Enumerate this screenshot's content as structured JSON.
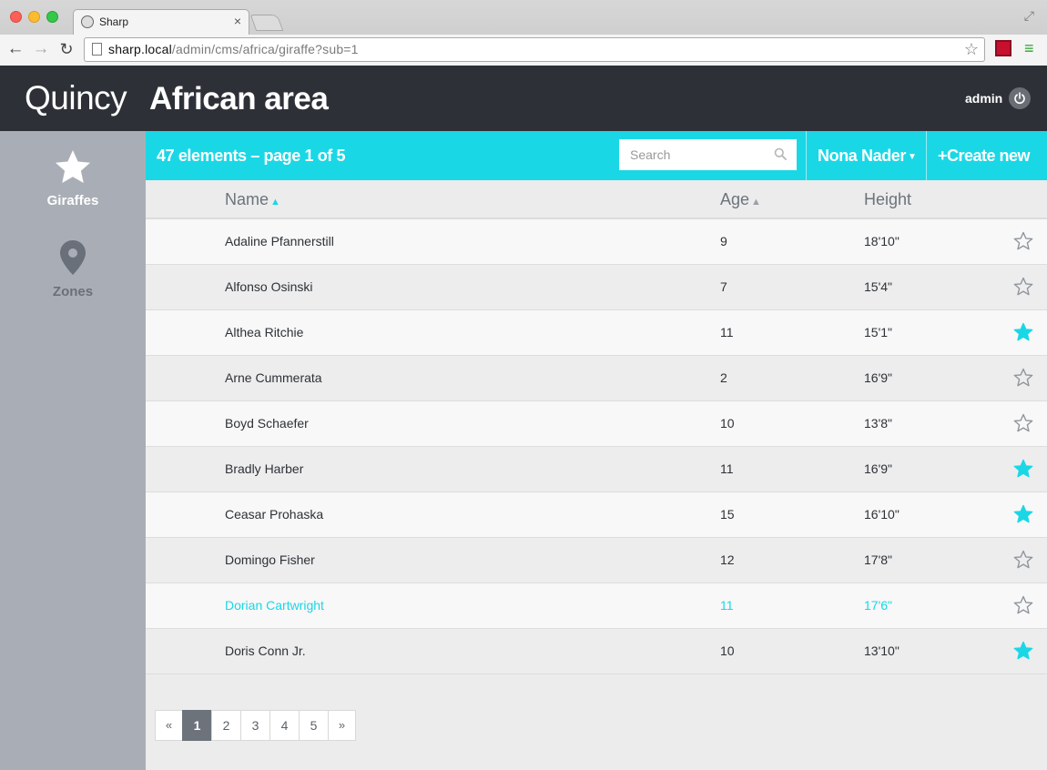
{
  "browser": {
    "tab_title": "Sharp",
    "tab_close": "×",
    "url_host": "sharp.local",
    "url_path": "/admin/cms/africa/giraffe?sub=1"
  },
  "header": {
    "brand": "Quincy",
    "title": "African area",
    "user": "admin"
  },
  "sidebar": {
    "items": [
      {
        "label": "Giraffes",
        "icon": "star-icon",
        "active": true
      },
      {
        "label": "Zones",
        "icon": "map-pin-icon",
        "active": false
      }
    ]
  },
  "actionbar": {
    "count_text": "47 elements – page 1 of 5",
    "search_placeholder": "Search",
    "user_select": "Nona Nader",
    "create_label": "Create new"
  },
  "table": {
    "columns": [
      "Name",
      "Age",
      "Height"
    ],
    "rows": [
      {
        "name": "Adaline Pfannerstill",
        "age": "9",
        "height": "18'10\"",
        "starred": false
      },
      {
        "name": "Alfonso Osinski",
        "age": "7",
        "height": "15'4\"",
        "starred": false
      },
      {
        "name": "Althea Ritchie",
        "age": "11",
        "height": "15'1\"",
        "starred": true
      },
      {
        "name": "Arne Cummerata",
        "age": "2",
        "height": "16'9\"",
        "starred": false
      },
      {
        "name": "Boyd Schaefer",
        "age": "10",
        "height": "13'8\"",
        "starred": false
      },
      {
        "name": "Bradly Harber",
        "age": "11",
        "height": "16'9\"",
        "starred": true
      },
      {
        "name": "Ceasar Prohaska",
        "age": "15",
        "height": "16'10\"",
        "starred": true
      },
      {
        "name": "Domingo Fisher",
        "age": "12",
        "height": "17'8\"",
        "starred": false
      },
      {
        "name": "Dorian Cartwright",
        "age": "11",
        "height": "17'6\"",
        "starred": false,
        "highlighted": true
      },
      {
        "name": "Doris Conn Jr.",
        "age": "10",
        "height": "13'10\"",
        "starred": true
      }
    ]
  },
  "pagination": {
    "prev": "«",
    "pages": [
      "1",
      "2",
      "3",
      "4",
      "5"
    ],
    "current": "1",
    "next": "»"
  },
  "colors": {
    "accent": "#1ad7e6",
    "header_bg": "#2d3137",
    "sidebar_bg": "#a9aeb6"
  }
}
